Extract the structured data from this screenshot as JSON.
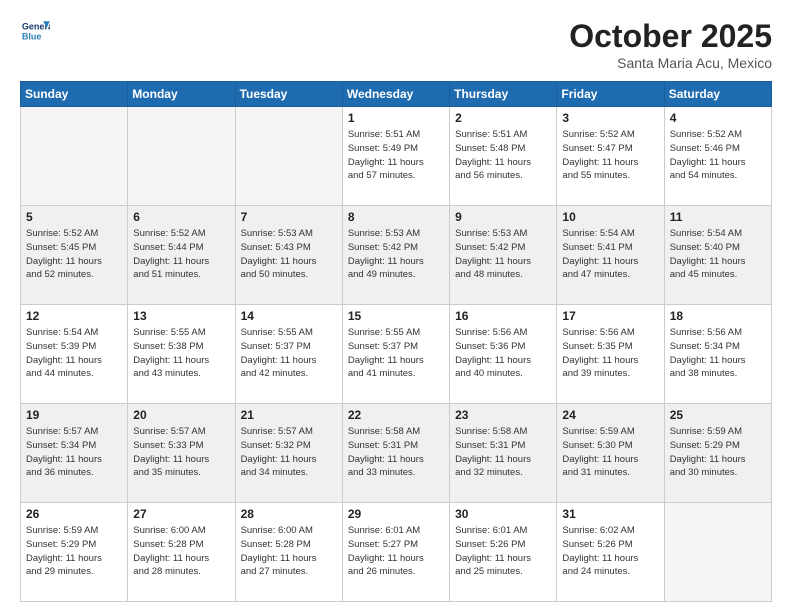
{
  "header": {
    "logo_line1": "General",
    "logo_line2": "Blue",
    "month_title": "October 2025",
    "subtitle": "Santa Maria Acu, Mexico"
  },
  "weekdays": [
    "Sunday",
    "Monday",
    "Tuesday",
    "Wednesday",
    "Thursday",
    "Friday",
    "Saturday"
  ],
  "weeks": [
    [
      {
        "day": "",
        "info": ""
      },
      {
        "day": "",
        "info": ""
      },
      {
        "day": "",
        "info": ""
      },
      {
        "day": "1",
        "info": "Sunrise: 5:51 AM\nSunset: 5:49 PM\nDaylight: 11 hours\nand 57 minutes."
      },
      {
        "day": "2",
        "info": "Sunrise: 5:51 AM\nSunset: 5:48 PM\nDaylight: 11 hours\nand 56 minutes."
      },
      {
        "day": "3",
        "info": "Sunrise: 5:52 AM\nSunset: 5:47 PM\nDaylight: 11 hours\nand 55 minutes."
      },
      {
        "day": "4",
        "info": "Sunrise: 5:52 AM\nSunset: 5:46 PM\nDaylight: 11 hours\nand 54 minutes."
      }
    ],
    [
      {
        "day": "5",
        "info": "Sunrise: 5:52 AM\nSunset: 5:45 PM\nDaylight: 11 hours\nand 52 minutes."
      },
      {
        "day": "6",
        "info": "Sunrise: 5:52 AM\nSunset: 5:44 PM\nDaylight: 11 hours\nand 51 minutes."
      },
      {
        "day": "7",
        "info": "Sunrise: 5:53 AM\nSunset: 5:43 PM\nDaylight: 11 hours\nand 50 minutes."
      },
      {
        "day": "8",
        "info": "Sunrise: 5:53 AM\nSunset: 5:42 PM\nDaylight: 11 hours\nand 49 minutes."
      },
      {
        "day": "9",
        "info": "Sunrise: 5:53 AM\nSunset: 5:42 PM\nDaylight: 11 hours\nand 48 minutes."
      },
      {
        "day": "10",
        "info": "Sunrise: 5:54 AM\nSunset: 5:41 PM\nDaylight: 11 hours\nand 47 minutes."
      },
      {
        "day": "11",
        "info": "Sunrise: 5:54 AM\nSunset: 5:40 PM\nDaylight: 11 hours\nand 45 minutes."
      }
    ],
    [
      {
        "day": "12",
        "info": "Sunrise: 5:54 AM\nSunset: 5:39 PM\nDaylight: 11 hours\nand 44 minutes."
      },
      {
        "day": "13",
        "info": "Sunrise: 5:55 AM\nSunset: 5:38 PM\nDaylight: 11 hours\nand 43 minutes."
      },
      {
        "day": "14",
        "info": "Sunrise: 5:55 AM\nSunset: 5:37 PM\nDaylight: 11 hours\nand 42 minutes."
      },
      {
        "day": "15",
        "info": "Sunrise: 5:55 AM\nSunset: 5:37 PM\nDaylight: 11 hours\nand 41 minutes."
      },
      {
        "day": "16",
        "info": "Sunrise: 5:56 AM\nSunset: 5:36 PM\nDaylight: 11 hours\nand 40 minutes."
      },
      {
        "day": "17",
        "info": "Sunrise: 5:56 AM\nSunset: 5:35 PM\nDaylight: 11 hours\nand 39 minutes."
      },
      {
        "day": "18",
        "info": "Sunrise: 5:56 AM\nSunset: 5:34 PM\nDaylight: 11 hours\nand 38 minutes."
      }
    ],
    [
      {
        "day": "19",
        "info": "Sunrise: 5:57 AM\nSunset: 5:34 PM\nDaylight: 11 hours\nand 36 minutes."
      },
      {
        "day": "20",
        "info": "Sunrise: 5:57 AM\nSunset: 5:33 PM\nDaylight: 11 hours\nand 35 minutes."
      },
      {
        "day": "21",
        "info": "Sunrise: 5:57 AM\nSunset: 5:32 PM\nDaylight: 11 hours\nand 34 minutes."
      },
      {
        "day": "22",
        "info": "Sunrise: 5:58 AM\nSunset: 5:31 PM\nDaylight: 11 hours\nand 33 minutes."
      },
      {
        "day": "23",
        "info": "Sunrise: 5:58 AM\nSunset: 5:31 PM\nDaylight: 11 hours\nand 32 minutes."
      },
      {
        "day": "24",
        "info": "Sunrise: 5:59 AM\nSunset: 5:30 PM\nDaylight: 11 hours\nand 31 minutes."
      },
      {
        "day": "25",
        "info": "Sunrise: 5:59 AM\nSunset: 5:29 PM\nDaylight: 11 hours\nand 30 minutes."
      }
    ],
    [
      {
        "day": "26",
        "info": "Sunrise: 5:59 AM\nSunset: 5:29 PM\nDaylight: 11 hours\nand 29 minutes."
      },
      {
        "day": "27",
        "info": "Sunrise: 6:00 AM\nSunset: 5:28 PM\nDaylight: 11 hours\nand 28 minutes."
      },
      {
        "day": "28",
        "info": "Sunrise: 6:00 AM\nSunset: 5:28 PM\nDaylight: 11 hours\nand 27 minutes."
      },
      {
        "day": "29",
        "info": "Sunrise: 6:01 AM\nSunset: 5:27 PM\nDaylight: 11 hours\nand 26 minutes."
      },
      {
        "day": "30",
        "info": "Sunrise: 6:01 AM\nSunset: 5:26 PM\nDaylight: 11 hours\nand 25 minutes."
      },
      {
        "day": "31",
        "info": "Sunrise: 6:02 AM\nSunset: 5:26 PM\nDaylight: 11 hours\nand 24 minutes."
      },
      {
        "day": "",
        "info": ""
      }
    ]
  ]
}
